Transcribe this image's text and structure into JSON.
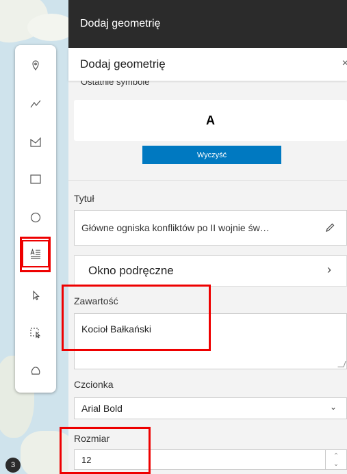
{
  "header": {
    "title": "Dodaj geometrię"
  },
  "subheader": {
    "title": "Dodaj geometrię",
    "close": "×"
  },
  "recent_symbols": {
    "label": "Ostatnie symbole",
    "symbol": "A",
    "clear_label": "Wyczyść"
  },
  "fields": {
    "title_label": "Tytuł",
    "title_value": "Główne ogniska konfliktów po II wojnie św…",
    "popup_label": "Okno podręczne",
    "content_label": "Zawartość",
    "content_value": "Kocioł Bałkański",
    "font_label": "Czcionka",
    "font_value": "Arial Bold",
    "size_label": "Rozmiar",
    "size_value": "12"
  },
  "map": {
    "badge": "3"
  },
  "toolbar": {
    "items": [
      "point",
      "polyline",
      "freehand-polygon",
      "rectangle",
      "circle",
      "text",
      "select",
      "select-area",
      "lasso"
    ]
  },
  "colors": {
    "accent": "#0079c1",
    "highlight": "#e00000",
    "header_bg": "#2b2b2b"
  }
}
